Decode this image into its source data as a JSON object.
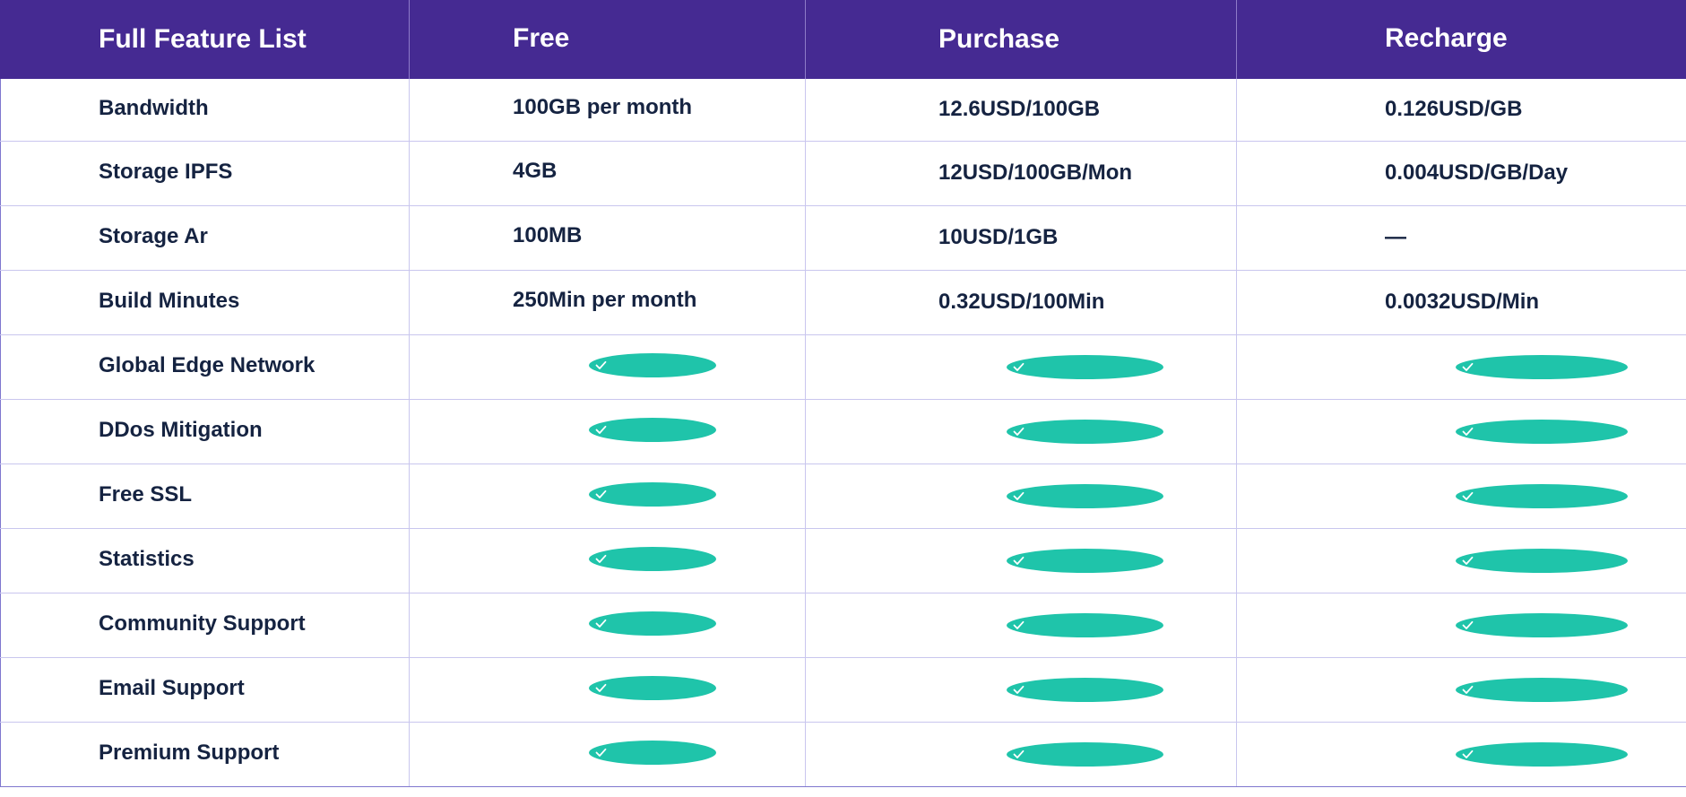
{
  "pricing_table": {
    "headers": [
      "Full Feature List",
      "Free",
      "Purchase",
      "Recharge"
    ],
    "rows": [
      {
        "feature": "Bandwidth",
        "free": "100GB per month",
        "purchase": "12.6USD/100GB",
        "recharge": "0.126USD/GB"
      },
      {
        "feature": "Storage IPFS",
        "free": "4GB",
        "purchase": "12USD/100GB/Mon",
        "recharge": "0.004USD/GB/Day"
      },
      {
        "feature": "Storage Ar",
        "free": "100MB",
        "purchase": "10USD/1GB",
        "recharge": "—"
      },
      {
        "feature": "Build Minutes",
        "free": "250Min  per month",
        "purchase": "0.32USD/100Min",
        "recharge": "0.0032USD/Min"
      }
    ],
    "check_rows": [
      {
        "feature": "Global Edge Network",
        "free": true,
        "purchase": true,
        "recharge": true
      },
      {
        "feature": "DDos Mitigation",
        "free": true,
        "purchase": true,
        "recharge": true
      },
      {
        "feature": "Free SSL",
        "free": true,
        "purchase": true,
        "recharge": true
      },
      {
        "feature": "Statistics",
        "free": true,
        "purchase": true,
        "recharge": true
      },
      {
        "feature": "Community Support",
        "free": true,
        "purchase": true,
        "recharge": true
      },
      {
        "feature": "Email Support",
        "free": true,
        "purchase": true,
        "recharge": true
      },
      {
        "feature": "Premium Support",
        "free": true,
        "purchase": true,
        "recharge": true
      }
    ],
    "icon": "check-circle-icon",
    "colors": {
      "header_bg": "#452a92",
      "header_text": "#ffffff",
      "body_text": "#152341",
      "check": "#1fc4aa",
      "grid": "#c9c6ee"
    }
  }
}
